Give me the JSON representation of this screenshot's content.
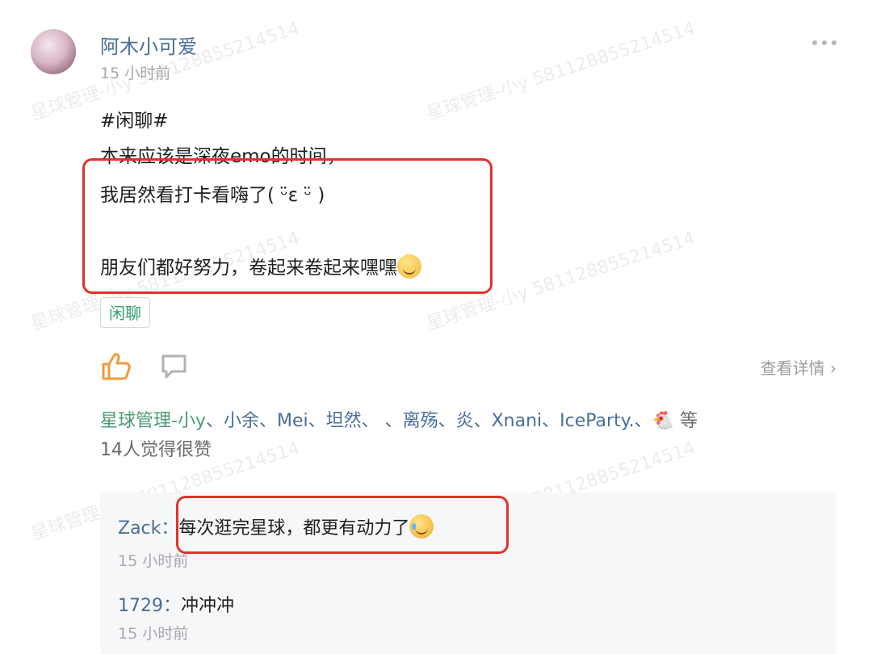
{
  "post": {
    "author": "阿木小可爱",
    "time": "15 小时前",
    "lines": [
      "#闲聊#",
      "本来应该是深夜emo的时间，",
      "我居然看打卡看嗨了( ᵕ̈ε ᵕ̈ )",
      "朋友们都好努力，卷起来卷起来嘿嘿"
    ],
    "tag": "闲聊",
    "detail_link": "查看详情",
    "emojis": {
      "line4": "smiling-face",
      "comment1": "tears-of-joy-face"
    }
  },
  "likes": {
    "users": "星球管理-小y",
    "list": "、小余、Mei、坦然、          、离殇、炎、Xnani、IceParty.、",
    "suffix": " 等",
    "count_text": "14人觉得很赞"
  },
  "comments": [
    {
      "author": "Zack：",
      "text": "每次逛完星球，都更有动力了",
      "time": "15 小时前"
    },
    {
      "author": "1729：",
      "text": "冲冲冲",
      "time": "15 小时前"
    }
  ],
  "watermark": "星球管理-小y 5811288552145​14",
  "colors": {
    "accent_red": "#e0332b",
    "like_orange": "#f29a3a",
    "link_blue": "#4a6e97",
    "tag_green": "#2f9e6b"
  }
}
